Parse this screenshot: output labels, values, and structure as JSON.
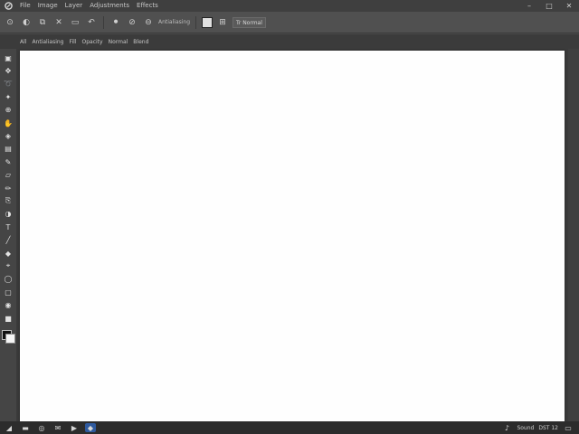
{
  "menubar": {
    "items": [
      "File",
      "Image",
      "Layer",
      "Adjustments",
      "Effects"
    ],
    "window_controls": {
      "minimize": "–",
      "maximize": "□",
      "close": "✕"
    }
  },
  "options": {
    "label": "Antialiasing",
    "select_value": "Tr Normal"
  },
  "tabbar": {
    "items": [
      "All",
      "Antialiasing",
      "Fill",
      "Opacity",
      "Normal",
      "Blend"
    ]
  },
  "tools": [
    "select-rectangle-icon",
    "move-icon",
    "lasso-icon",
    "magic-wand-icon",
    "zoom-icon",
    "pan-icon",
    "paint-bucket-icon",
    "gradient-icon",
    "brush-icon",
    "eraser-icon",
    "pencil-icon",
    "clone-icon",
    "recolor-icon",
    "text-icon",
    "line-icon",
    "shape-icon",
    "color-picker-icon",
    "ellipse-icon",
    "rounded-rect-icon",
    "freeform-icon",
    "blur-icon"
  ],
  "taskbar": {
    "status": "Sound",
    "clock": "DST 12"
  },
  "colors": {
    "primary": "#111111",
    "secondary": "#f5f5f5",
    "accent": "#2f5a9e"
  }
}
